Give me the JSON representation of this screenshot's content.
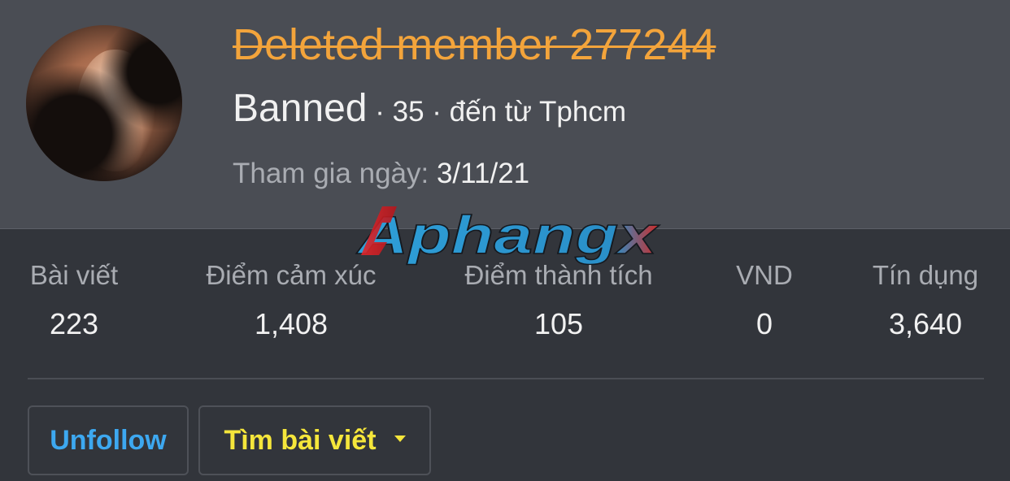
{
  "profile": {
    "name": "Deleted member 277244",
    "title": "Banned",
    "details": " · 35 · đến từ Tphcm",
    "joined_label": "Tham gia ngày: ",
    "joined_value": "3/11/21"
  },
  "watermark": {
    "text": "Aphangx"
  },
  "stats": [
    {
      "label": "Bài viết",
      "value": "223"
    },
    {
      "label": "Điểm cảm xúc",
      "value": "1,408"
    },
    {
      "label": "Điểm thành tích",
      "value": "105"
    },
    {
      "label": "VND",
      "value": "0"
    },
    {
      "label": "Tín dụng",
      "value": "3,640"
    }
  ],
  "buttons": {
    "unfollow": "Unfollow",
    "find_posts": "Tìm bài viết"
  },
  "colors": {
    "name": "#f3a43b",
    "unfollow": "#3da8f0",
    "find_posts": "#f5e63b"
  }
}
